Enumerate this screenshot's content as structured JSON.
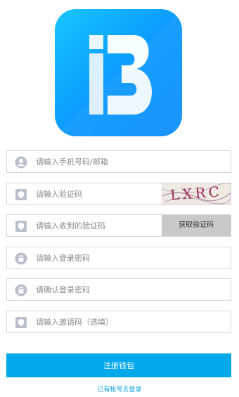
{
  "logo": {
    "icon": "ib-logo-icon",
    "gradient_start": "#18c6ff",
    "gradient_end": "#0b8dfa"
  },
  "form": {
    "phone_email": {
      "placeholder": "请输入手机号码/邮箱",
      "icon": "user-icon"
    },
    "captcha": {
      "placeholder": "请输入验证码",
      "icon": "shield-icon",
      "image_text": "LXRC"
    },
    "sms_code": {
      "placeholder": "请输入收到的验证码",
      "icon": "shield-icon",
      "button_label": "获取验证码"
    },
    "password": {
      "placeholder": "请输入登录密码",
      "icon": "lock-icon"
    },
    "confirm_password": {
      "placeholder": "请确认登录密码",
      "icon": "lock-icon"
    },
    "invite_code": {
      "placeholder": "请输入邀请码（选填）",
      "icon": "shield-icon"
    }
  },
  "actions": {
    "submit_label": "注册钱包",
    "login_link": "已有帐号去登录"
  },
  "colors": {
    "primary": "#02a8ea",
    "link": "#0aa1e6",
    "border": "#d7d7d7",
    "icon": "#b9bfcc"
  }
}
